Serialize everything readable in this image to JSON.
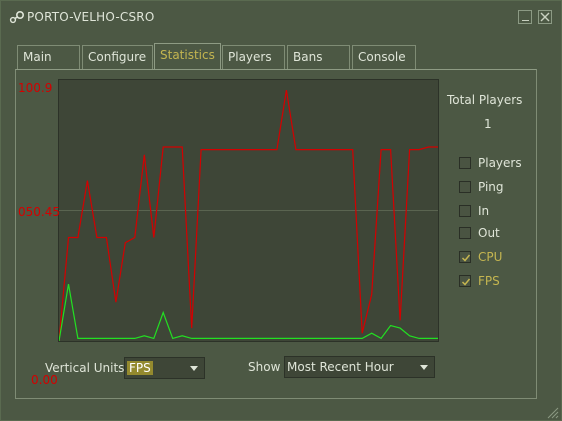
{
  "window": {
    "title": "PORTO-VELHO-CSRO"
  },
  "tabs": [
    {
      "label": "Main"
    },
    {
      "label": "Configure"
    },
    {
      "label": "Statistics"
    },
    {
      "label": "Players"
    },
    {
      "label": "Bans"
    },
    {
      "label": "Console"
    }
  ],
  "stats": {
    "total_players_label": "Total Players",
    "total_players_value": "1",
    "series_toggles": [
      {
        "label": "Players",
        "checked": false
      },
      {
        "label": "Ping",
        "checked": false
      },
      {
        "label": "In",
        "checked": false
      },
      {
        "label": "Out",
        "checked": false
      },
      {
        "label": "CPU",
        "checked": true
      },
      {
        "label": "FPS",
        "checked": true
      }
    ],
    "vertical_units_label": "Vertical Units",
    "vertical_units_value": "FPS",
    "show_label": "Show",
    "show_value": "Most Recent Hour"
  },
  "colors": {
    "cpu_line": "#d40000",
    "fps_line": "#22e022",
    "gridline": "#5a6450",
    "accent": "#c4b550"
  },
  "chart_data": {
    "type": "line",
    "y_tick_labels": [
      "100.9",
      "050.45",
      "0.00"
    ],
    "ylim": [
      0,
      100.9
    ],
    "grid": "horizontal midline",
    "series": [
      {
        "name": "CPU",
        "x": [
          0,
          1,
          2,
          3,
          4,
          5,
          6,
          7,
          8,
          9,
          10,
          11,
          12,
          13,
          14,
          15,
          16,
          17,
          18,
          19,
          20,
          21,
          22,
          23,
          24,
          25,
          26,
          27,
          28,
          29,
          30,
          31,
          32,
          33,
          34,
          35,
          36,
          37,
          38,
          39,
          40
        ],
        "values": [
          0,
          40,
          40,
          62,
          40,
          40,
          15,
          38,
          40,
          72,
          40,
          75,
          75,
          75,
          5,
          74,
          74,
          74,
          74,
          74,
          74,
          74,
          74,
          74,
          97,
          74,
          74,
          74,
          74,
          74,
          74,
          74,
          3,
          18,
          74,
          74,
          8,
          74,
          74,
          75,
          75
        ]
      },
      {
        "name": "FPS",
        "x": [
          0,
          1,
          2,
          3,
          4,
          5,
          6,
          7,
          8,
          9,
          10,
          11,
          12,
          13,
          14,
          15,
          16,
          17,
          18,
          19,
          20,
          21,
          22,
          23,
          24,
          25,
          26,
          27,
          28,
          29,
          30,
          31,
          32,
          33,
          34,
          35,
          36,
          37,
          38,
          39,
          40
        ],
        "values": [
          0,
          22,
          1,
          1,
          1,
          1,
          1,
          1,
          1,
          2,
          1,
          11,
          1,
          2,
          1,
          1,
          1,
          1,
          1,
          1,
          1,
          1,
          1,
          1,
          1,
          1,
          1,
          1,
          1,
          1,
          1,
          1,
          1,
          3,
          1,
          6,
          5,
          2,
          1,
          1,
          1
        ]
      }
    ]
  }
}
